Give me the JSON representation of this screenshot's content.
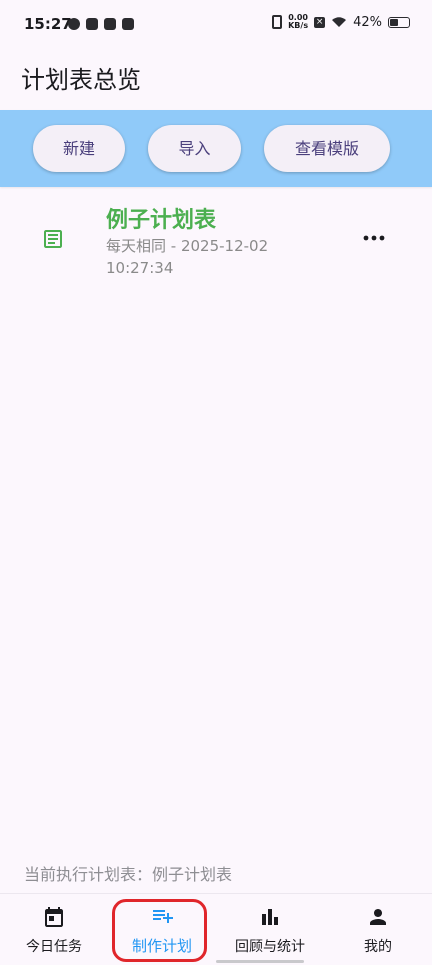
{
  "status_bar": {
    "time": "15:27",
    "net_speed_value": "0.00",
    "net_speed_unit": "KB/s",
    "battery": "42%",
    "battery_level": 0.42
  },
  "page": {
    "title": "计划表总览"
  },
  "toolbar": {
    "new_label": "新建",
    "import_label": "导入",
    "template_label": "查看模版"
  },
  "plans": [
    {
      "name": "例子计划表",
      "meta": "每天相同 -  2025-12-02 10:27:34",
      "icon": "document-icon",
      "more_icon": "more-horizontal-icon",
      "name_color": "#4caf50"
    }
  ],
  "current_plan": {
    "text": "当前执行计划表：例子计划表"
  },
  "bottom_nav": {
    "items": [
      {
        "label": "今日任务",
        "icon": "calendar-icon"
      },
      {
        "label": "制作计划",
        "icon": "playlist-add-icon",
        "active": true
      },
      {
        "label": "回顾与统计",
        "icon": "bar-chart-icon"
      },
      {
        "label": "我的",
        "icon": "person-icon"
      }
    ]
  },
  "colors": {
    "toolbar_bg": "#90caf9",
    "accent": "#2196f3",
    "highlight": "#e0262b",
    "background": "#fcf7fd"
  }
}
